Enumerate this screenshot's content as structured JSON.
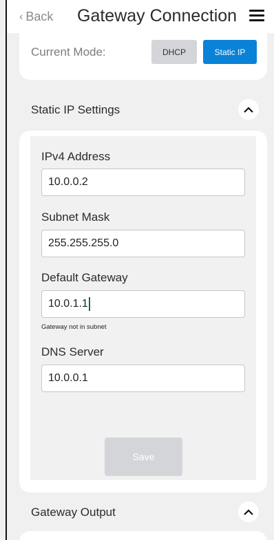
{
  "header": {
    "back_label": "Back",
    "title": "Gateway Connection",
    "back_icon": "chevron-left-icon",
    "menu_icon": "hamburger-menu-icon"
  },
  "mode": {
    "label": "Current Mode:",
    "options": [
      "DHCP",
      "Static IP"
    ],
    "selected": "Static IP",
    "colors": {
      "selected_bg": "#0a82d8",
      "unselected_bg": "#d3d5d9"
    }
  },
  "static_settings": {
    "title": "Static IP Settings",
    "toggle_icon": "chevron-up-icon",
    "fields": [
      {
        "label": "IPv4 Address",
        "value": "10.0.0.2"
      },
      {
        "label": "Subnet Mask",
        "value": "255.255.255.0"
      },
      {
        "label": "Default Gateway",
        "value": "10.0.1.1",
        "error": "Gateway not in subnet"
      },
      {
        "label": "DNS Server",
        "value": "10.0.0.1"
      }
    ],
    "save_label": "Save"
  },
  "gateway_output": {
    "title": "Gateway Output",
    "toggle_icon": "chevron-up-icon"
  }
}
